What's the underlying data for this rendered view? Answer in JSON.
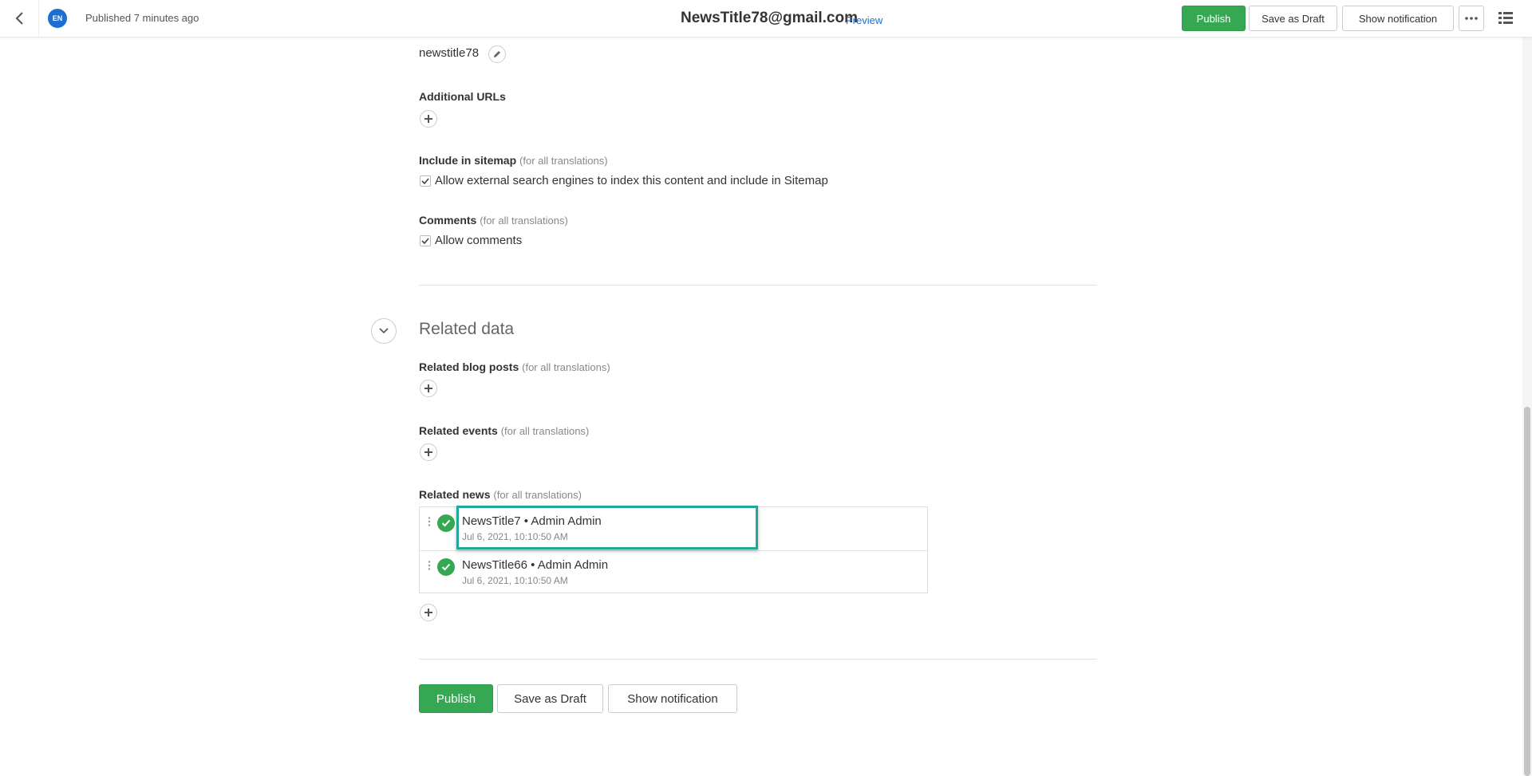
{
  "header": {
    "language": "EN",
    "status": "Published 7 minutes ago",
    "title": "NewsTitle78@gmail.com",
    "preview_label": "Preview",
    "publish_label": "Publish",
    "draft_label": "Save as Draft",
    "notify_label": "Show notification",
    "more_label": "•••"
  },
  "url": {
    "value": "newstitle78"
  },
  "additional_urls": {
    "label": "Additional URLs"
  },
  "sitemap": {
    "label": "Include in sitemap",
    "note": "(for all translations)",
    "checkbox_label": "Allow external search engines to index this content and include in Sitemap",
    "checked": true
  },
  "comments": {
    "label": "Comments",
    "note": "(for all translations)",
    "checkbox_label": "Allow comments",
    "checked": true
  },
  "related": {
    "section_title": "Related data",
    "blog_posts": {
      "label": "Related blog posts",
      "note": "(for all translations)"
    },
    "events": {
      "label": "Related events",
      "note": "(for all translations)"
    },
    "news": {
      "label": "Related news",
      "note": "(for all translations)",
      "items": [
        {
          "title": "NewsTitle7 • Admin Admin",
          "date": "Jul 6, 2021, 10:10:50 AM"
        },
        {
          "title": "NewsTitle66 • Admin Admin",
          "date": "Jul 6, 2021, 10:10:50 AM"
        }
      ]
    }
  },
  "footer": {
    "publish_label": "Publish",
    "draft_label": "Save as Draft",
    "notify_label": "Show notification"
  },
  "colors": {
    "accent_green": "#36a853",
    "link_blue": "#1c6fd1",
    "highlight_teal": "#21a89a"
  }
}
